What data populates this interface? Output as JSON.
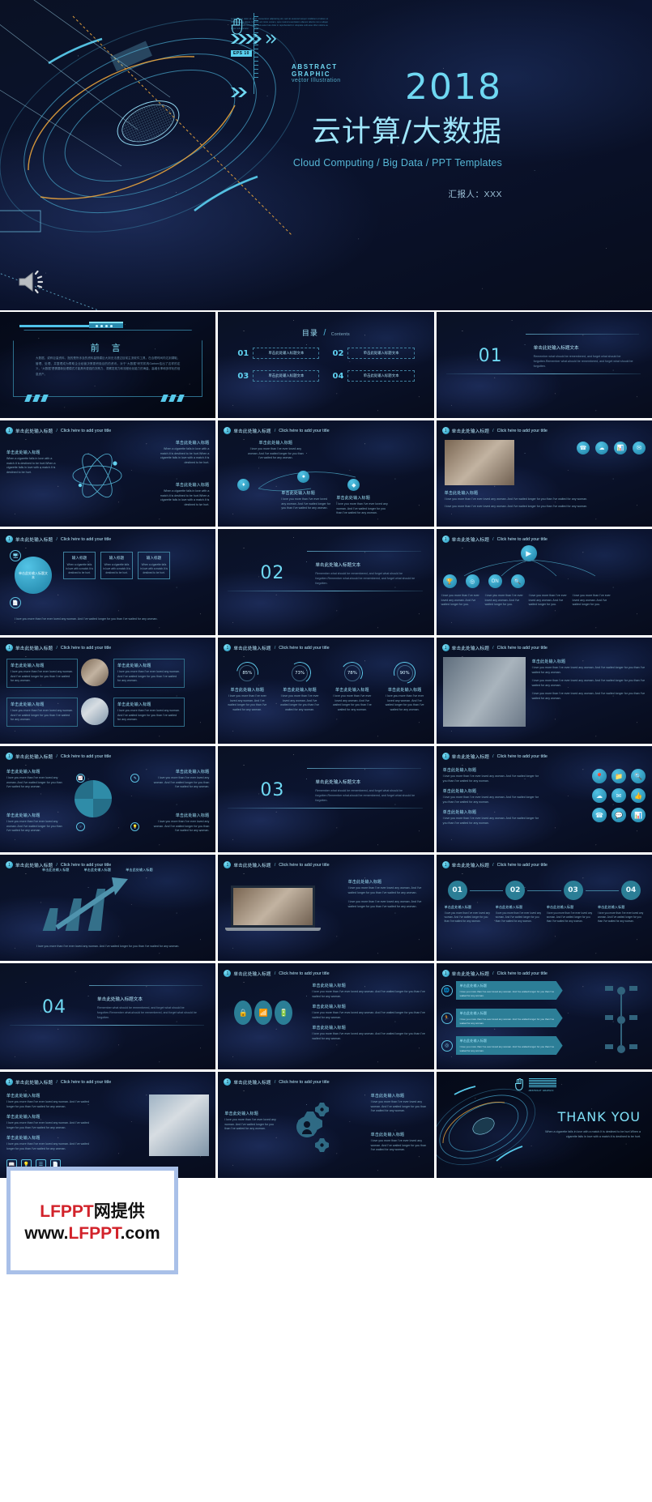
{
  "hero": {
    "year": "2018",
    "title": "云计算/大数据",
    "subtitle": "Cloud Computing / Big Data / PPT Templates",
    "presenter": "汇报人：XXX",
    "eps_tag": "EPS 10",
    "abstract_line1": "ABSTRACT GRAPHIC",
    "abstract_line2": "vector Illustration",
    "lorem": "Lorem ipsum dolor sit amet, consectetur adipisicing elit, sed do eiusmod tempor incididunt ut labore et dolore magna aliqua. Ut enim ad minim veniam, quis nostrud exercitation ullamco laboris nisi ut aliquip ex ea commodo consequat. Duis aute irure dolor in reprehenderit in voluptate velit esse cillum dolore eu fugiat nulla pariatur.",
    "speaker_icon": "speaker-icon",
    "cursor_icon": "pointer-hand-icon",
    "colors": {
      "accent": "#6fd8f2",
      "title": "#9fe6fb",
      "sub": "#56b7d6",
      "bg": "#070d1e"
    }
  },
  "common": {
    "slide_header_zh": "单击此处输入标题",
    "slide_header_sep": "/",
    "slide_header_en": "Click here to add your title",
    "mini_title": "单击此处输入标题",
    "body_en": "I love you more than I've ever loved any woman. And I've waited longer for you than I've waited for any woman.",
    "body_en_short": "I love you more than I've ever loved any woman. And I've waited longer for you.",
    "remember_text": "Remember what should be remembered, and forget what should be forgotten.Remember what should be remembered, and forget what should be forgotten.",
    "cigarette_text": "When a cigarette falls in love with a match.It is destined to be hurt.When a cigarette falls in love with a match.It is destined to be hurt."
  },
  "slides": [
    {
      "index": 1,
      "kind": "preface",
      "title": "前 言",
      "body": "大数据，或称巨量资料，指的是所涉及的资料量规模巨大到无法透过目前主流软件工具，在合理时间内达到撷取、管理、处理、并整理成为帮助企业经营决策更积极目的的资讯。对于“大数据”研究机构Gartner给出了这样的定义，“大数据”是需要新处理模式才能具有更强的决策力、洞察发现力和流程优化能力的海量、高增长率和多样化的信息资产。"
    },
    {
      "index": 2,
      "kind": "contents",
      "title_zh": "目录",
      "title_sep": "/",
      "title_en": "Contents",
      "items": [
        {
          "num": "01",
          "label": "单击此处输入标题文本"
        },
        {
          "num": "02",
          "label": "单击此处输入标题文本"
        },
        {
          "num": "03",
          "label": "单击此处输入标题文本"
        },
        {
          "num": "04",
          "label": "单击此处输入标题文本"
        }
      ]
    },
    {
      "index": 3,
      "kind": "section",
      "num": "01",
      "title": "单击此处输入标题文本",
      "desc": "Remember what should be remembered, and forget what should be forgotten.Remember what should be remembered, and forget what should be forgotten."
    },
    {
      "index": 4,
      "kind": "atom"
    },
    {
      "index": 5,
      "kind": "three-dots"
    },
    {
      "index": 6,
      "kind": "photo-icons"
    },
    {
      "index": 7,
      "kind": "hub-boxes"
    },
    {
      "index": 8,
      "kind": "section",
      "num": "02",
      "title": "单击此处输入标题文本",
      "desc": "Remember what should be remembered, and forget what should be forgotten.Remember what should be remembered, and forget what should be forgotten."
    },
    {
      "index": 9,
      "kind": "four-circle-icons"
    },
    {
      "index": 10,
      "kind": "two-photo-text"
    },
    {
      "index": 11,
      "kind": "percent-rings"
    },
    {
      "index": 12,
      "kind": "big-photo"
    },
    {
      "index": 13,
      "kind": "pie-quad"
    },
    {
      "index": 14,
      "kind": "section",
      "num": "03",
      "title": "单击此处输入标题文本",
      "desc": "Remember what should be remembered, and forget what should be forgotten.Remember what should be remembered, and forget what should be forgotten."
    },
    {
      "index": 15,
      "kind": "icon-grid"
    },
    {
      "index": 16,
      "kind": "arrow-bars"
    },
    {
      "index": 17,
      "kind": "laptop-photo"
    },
    {
      "index": 18,
      "kind": "step-numbers"
    },
    {
      "index": 19,
      "kind": "section",
      "num": "04",
      "title": "单击此处输入标题文本",
      "desc": "Remember what should be remembered, and forget what should be forgotten.Remember what should be remembered, and forget what should be forgotten."
    },
    {
      "index": 20,
      "kind": "three-oval-icons"
    },
    {
      "index": 21,
      "kind": "arrow-rows"
    },
    {
      "index": 22,
      "kind": "photo-list"
    },
    {
      "index": 23,
      "kind": "gear-text"
    },
    {
      "index": 24,
      "kind": "thankyou",
      "title": "THANK YOU",
      "desc": "When a cigarette falls in love with a match.It is destined to be hurt.When a cigarette falls in love with a match.It is destined to be hurt."
    }
  ],
  "percent_rings": {
    "values": [
      "85%",
      "73%",
      "78%",
      "90%"
    ],
    "labels": [
      "单击此处输入标题",
      "单击此处输入标题",
      "单击此处输入标题",
      "单击此处输入标题"
    ]
  },
  "step_numbers": {
    "values": [
      "01",
      "02",
      "03",
      "04"
    ]
  },
  "hub_boxes": {
    "center": "单击此处输入标题文本",
    "boxes": [
      "输入标题",
      "输入标题",
      "输入标题"
    ],
    "caption": "When a cigarette falls in love with a match.It is destined to be hurt."
  },
  "icons": {
    "phone": "phone-icon",
    "handshake": "handshake-icon",
    "chart": "bar-chart-icon",
    "pin": "map-pin-icon",
    "folder": "folder-icon",
    "search": "search-icon",
    "cloud": "cloud-icon",
    "mail": "mail-icon",
    "thumb": "thumbs-up-icon",
    "gear": "gear-icon",
    "user": "user-icon",
    "lock": "lock-icon",
    "wifi": "wifi-icon",
    "battery": "battery-icon",
    "play": "play-icon",
    "monitor": "monitor-icon",
    "doc": "document-icon",
    "bulb": "lightbulb-icon",
    "target": "target-icon",
    "run": "running-icon",
    "trophy": "trophy-icon"
  },
  "watermark": {
    "line1_black": "网提供",
    "line1_red": "LFPPT",
    "line2_prefix": "www.",
    "line2_red": "LFPPT",
    "line2_suffix": ".com",
    "border_color": "#a9c0e8"
  },
  "chart_data": {
    "type": "bar",
    "title": "单击此处输入标题",
    "categories": [
      "单击此处输入标题",
      "单击此处输入标题",
      "单击此处输入标题"
    ],
    "values": [
      40,
      62,
      85
    ],
    "ylim": [
      0,
      100
    ],
    "xlabel": "",
    "ylabel": ""
  },
  "percent_chart": {
    "type": "bar",
    "title": "",
    "categories": [
      "85%",
      "73%",
      "78%",
      "90%"
    ],
    "values": [
      85,
      73,
      78,
      90
    ],
    "ylim": [
      0,
      100
    ]
  }
}
